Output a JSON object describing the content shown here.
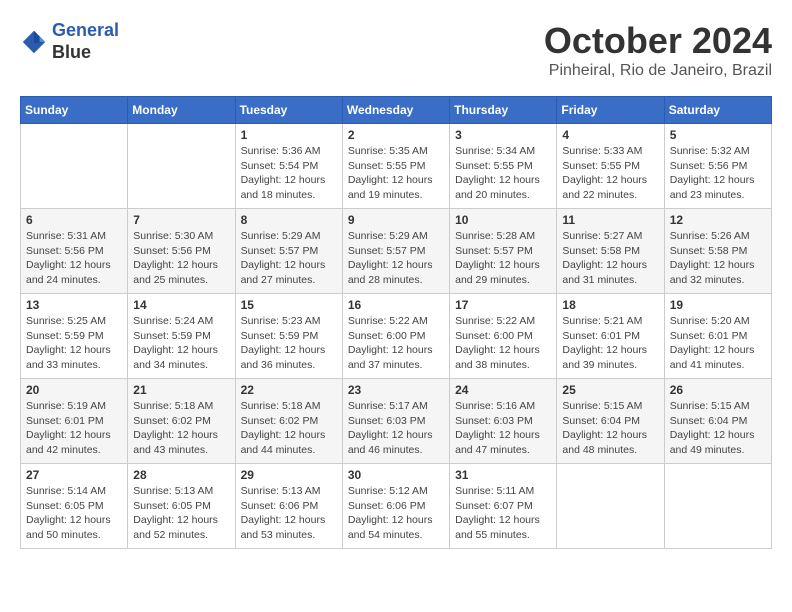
{
  "header": {
    "logo_line1": "General",
    "logo_line2": "Blue",
    "month": "October 2024",
    "location": "Pinheiral, Rio de Janeiro, Brazil"
  },
  "days_of_week": [
    "Sunday",
    "Monday",
    "Tuesday",
    "Wednesday",
    "Thursday",
    "Friday",
    "Saturday"
  ],
  "weeks": [
    [
      {
        "num": "",
        "info": ""
      },
      {
        "num": "",
        "info": ""
      },
      {
        "num": "1",
        "info": "Sunrise: 5:36 AM\nSunset: 5:54 PM\nDaylight: 12 hours and 18 minutes."
      },
      {
        "num": "2",
        "info": "Sunrise: 5:35 AM\nSunset: 5:55 PM\nDaylight: 12 hours and 19 minutes."
      },
      {
        "num": "3",
        "info": "Sunrise: 5:34 AM\nSunset: 5:55 PM\nDaylight: 12 hours and 20 minutes."
      },
      {
        "num": "4",
        "info": "Sunrise: 5:33 AM\nSunset: 5:55 PM\nDaylight: 12 hours and 22 minutes."
      },
      {
        "num": "5",
        "info": "Sunrise: 5:32 AM\nSunset: 5:56 PM\nDaylight: 12 hours and 23 minutes."
      }
    ],
    [
      {
        "num": "6",
        "info": "Sunrise: 5:31 AM\nSunset: 5:56 PM\nDaylight: 12 hours and 24 minutes."
      },
      {
        "num": "7",
        "info": "Sunrise: 5:30 AM\nSunset: 5:56 PM\nDaylight: 12 hours and 25 minutes."
      },
      {
        "num": "8",
        "info": "Sunrise: 5:29 AM\nSunset: 5:57 PM\nDaylight: 12 hours and 27 minutes."
      },
      {
        "num": "9",
        "info": "Sunrise: 5:29 AM\nSunset: 5:57 PM\nDaylight: 12 hours and 28 minutes."
      },
      {
        "num": "10",
        "info": "Sunrise: 5:28 AM\nSunset: 5:57 PM\nDaylight: 12 hours and 29 minutes."
      },
      {
        "num": "11",
        "info": "Sunrise: 5:27 AM\nSunset: 5:58 PM\nDaylight: 12 hours and 31 minutes."
      },
      {
        "num": "12",
        "info": "Sunrise: 5:26 AM\nSunset: 5:58 PM\nDaylight: 12 hours and 32 minutes."
      }
    ],
    [
      {
        "num": "13",
        "info": "Sunrise: 5:25 AM\nSunset: 5:59 PM\nDaylight: 12 hours and 33 minutes."
      },
      {
        "num": "14",
        "info": "Sunrise: 5:24 AM\nSunset: 5:59 PM\nDaylight: 12 hours and 34 minutes."
      },
      {
        "num": "15",
        "info": "Sunrise: 5:23 AM\nSunset: 5:59 PM\nDaylight: 12 hours and 36 minutes."
      },
      {
        "num": "16",
        "info": "Sunrise: 5:22 AM\nSunset: 6:00 PM\nDaylight: 12 hours and 37 minutes."
      },
      {
        "num": "17",
        "info": "Sunrise: 5:22 AM\nSunset: 6:00 PM\nDaylight: 12 hours and 38 minutes."
      },
      {
        "num": "18",
        "info": "Sunrise: 5:21 AM\nSunset: 6:01 PM\nDaylight: 12 hours and 39 minutes."
      },
      {
        "num": "19",
        "info": "Sunrise: 5:20 AM\nSunset: 6:01 PM\nDaylight: 12 hours and 41 minutes."
      }
    ],
    [
      {
        "num": "20",
        "info": "Sunrise: 5:19 AM\nSunset: 6:01 PM\nDaylight: 12 hours and 42 minutes."
      },
      {
        "num": "21",
        "info": "Sunrise: 5:18 AM\nSunset: 6:02 PM\nDaylight: 12 hours and 43 minutes."
      },
      {
        "num": "22",
        "info": "Sunrise: 5:18 AM\nSunset: 6:02 PM\nDaylight: 12 hours and 44 minutes."
      },
      {
        "num": "23",
        "info": "Sunrise: 5:17 AM\nSunset: 6:03 PM\nDaylight: 12 hours and 46 minutes."
      },
      {
        "num": "24",
        "info": "Sunrise: 5:16 AM\nSunset: 6:03 PM\nDaylight: 12 hours and 47 minutes."
      },
      {
        "num": "25",
        "info": "Sunrise: 5:15 AM\nSunset: 6:04 PM\nDaylight: 12 hours and 48 minutes."
      },
      {
        "num": "26",
        "info": "Sunrise: 5:15 AM\nSunset: 6:04 PM\nDaylight: 12 hours and 49 minutes."
      }
    ],
    [
      {
        "num": "27",
        "info": "Sunrise: 5:14 AM\nSunset: 6:05 PM\nDaylight: 12 hours and 50 minutes."
      },
      {
        "num": "28",
        "info": "Sunrise: 5:13 AM\nSunset: 6:05 PM\nDaylight: 12 hours and 52 minutes."
      },
      {
        "num": "29",
        "info": "Sunrise: 5:13 AM\nSunset: 6:06 PM\nDaylight: 12 hours and 53 minutes."
      },
      {
        "num": "30",
        "info": "Sunrise: 5:12 AM\nSunset: 6:06 PM\nDaylight: 12 hours and 54 minutes."
      },
      {
        "num": "31",
        "info": "Sunrise: 5:11 AM\nSunset: 6:07 PM\nDaylight: 12 hours and 55 minutes."
      },
      {
        "num": "",
        "info": ""
      },
      {
        "num": "",
        "info": ""
      }
    ]
  ]
}
